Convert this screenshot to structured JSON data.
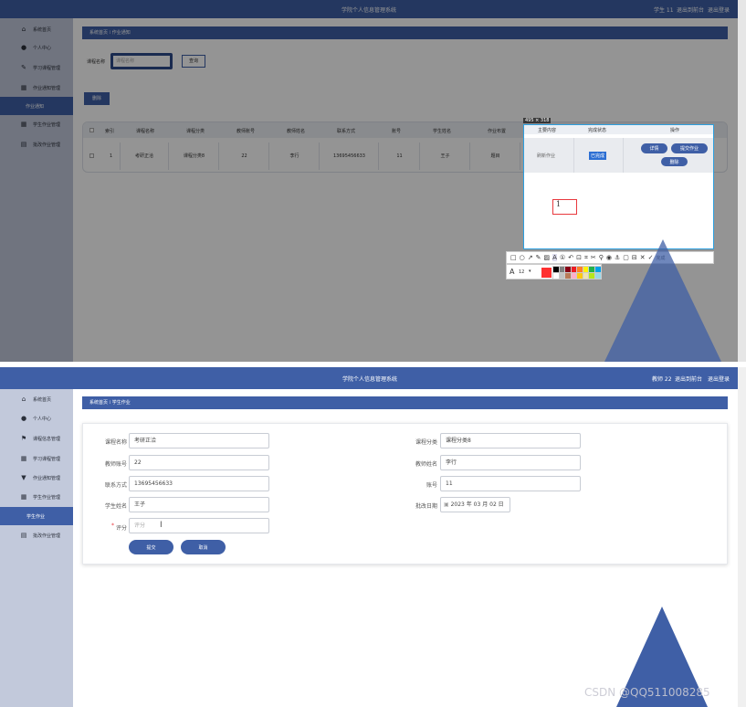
{
  "app_title": "学院个人信息管理系统",
  "top_screen": {
    "header_user": "学生 11",
    "header_links": [
      "退出到前台",
      "退出登录"
    ],
    "sidebar": [
      "系统首页",
      "个人中心",
      "学习课程管理",
      "作业通知管理",
      "作业通知",
      "学生作业管理",
      "批改作业管理"
    ],
    "active_item": "作业通知",
    "breadcrumb_home": "系统首页",
    "breadcrumb_current": "作业通知",
    "search_label": "课程名称",
    "search_placeholder": "课程名称",
    "search_button": "查询",
    "delete_button": "删除",
    "table_headers": [
      "索引",
      "课程名称",
      "课程分类",
      "教师账号",
      "教师姓名",
      "联系方式",
      "账号",
      "学生姓名",
      "作业布置"
    ],
    "table_row": [
      "1",
      "考研正洽",
      "课程分类8",
      "22",
      "李行",
      "13695456633",
      "11",
      "王子",
      "题目"
    ],
    "overlay_headers": [
      "主要内容",
      "完成状态",
      "操作"
    ],
    "overlay_row": [
      "刷新作业",
      "已完成"
    ],
    "overlay_buttons": [
      "详情",
      "提交作业",
      "删除"
    ],
    "selection_size": "495 × 318",
    "text_box_value": "1",
    "toolbar_font_size": "12",
    "toolbar_done": "完成",
    "palette": [
      "#000000",
      "#7f7f7f",
      "#880015",
      "#ed1c24",
      "#ff7f27",
      "#fff200",
      "#22b14c",
      "#00a2e8",
      "#ffffff",
      "#c3c3c3",
      "#b97a57",
      "#ffaec9",
      "#ffc90e",
      "#efe4b0",
      "#b5e61d",
      "#99d9ea"
    ]
  },
  "bottom_screen": {
    "header_user": "教师 22",
    "header_links": [
      "退出到前台",
      "退出登录"
    ],
    "sidebar": [
      "系统首页",
      "个人中心",
      "课程信息管理",
      "学习课程管理",
      "作业通知管理",
      "学生作业管理",
      "学生作业",
      "批改作业管理"
    ],
    "active_item": "学生作业",
    "breadcrumb_home": "系统首页",
    "breadcrumb_current": "学生作业",
    "form": {
      "course_name_label": "课程名称",
      "course_name": "考研正洽",
      "course_type_label": "课程分类",
      "course_type": "课程分类8",
      "teacher_account_label": "教师账号",
      "teacher_account": "22",
      "teacher_name_label": "教师姓名",
      "teacher_name": "李行",
      "contact_label": "联系方式",
      "contact": "13695456633",
      "account_label": "账号",
      "account": "11",
      "student_name_label": "学生姓名",
      "student_name": "王子",
      "grade_date_label": "批改日期",
      "grade_date": "2023 年 03 月 02 日",
      "score_label": "评分",
      "score_required": "*",
      "score_placeholder": "评分"
    },
    "submit_button": "提交",
    "cancel_button": "取消"
  },
  "watermark": "CSDN @QQ511008285",
  "colors": {
    "header": "#3f5fa6",
    "sidebar": "#c2c9db",
    "active": "#3f5fa6",
    "accent": "#e8383d"
  }
}
